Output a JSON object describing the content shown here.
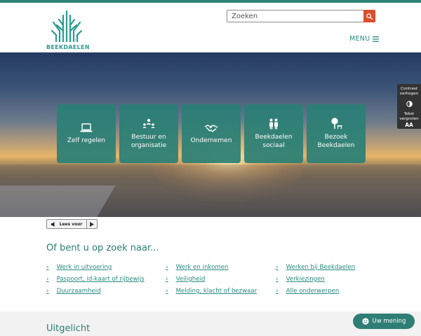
{
  "header": {
    "logo_text": "BEEKDAELEN",
    "search_placeholder": "Zoeken",
    "menu_label": "MENU"
  },
  "hero": {
    "tiles": [
      {
        "label_line1": "Zelf regelen",
        "label_line2": "",
        "icon": "laptop-icon"
      },
      {
        "label_line1": "Bestuur en",
        "label_line2": "organisatie",
        "icon": "organisation-icon"
      },
      {
        "label_line1": "Ondernemen",
        "label_line2": "",
        "icon": "handshake-icon"
      },
      {
        "label_line1": "Beekdaelen",
        "label_line2": "sociaal",
        "icon": "people-icon"
      },
      {
        "label_line1": "Bezoek",
        "label_line2": "Beekdaelen",
        "icon": "tree-bench-icon"
      }
    ]
  },
  "accessibility": {
    "contrast_line1": "Contrast",
    "contrast_line2": "verhogen",
    "text_line1": "Tekst",
    "text_line2": "vergroten",
    "text_glyph": "AA"
  },
  "readspeaker": {
    "label": "Lees voor"
  },
  "search_section": {
    "title": "Of bent u op zoek naar...",
    "links": [
      "Werk in uitvoering",
      "Paspoort, id-kaart of rijbewijs",
      "Duurzaamheid",
      "Werk en inkomen",
      "Veiligheid",
      "Melding, klacht of bezwaar",
      "Werken bij Beekdaelen",
      "Verkiezingen",
      "Alle onderwerpen"
    ]
  },
  "featured": {
    "title": "Uitgelicht"
  },
  "feedback": {
    "label": "Uw mening"
  },
  "colors": {
    "brand_teal": "#2e8277",
    "search_button": "#d94f2b",
    "link": "#2a8a80"
  }
}
